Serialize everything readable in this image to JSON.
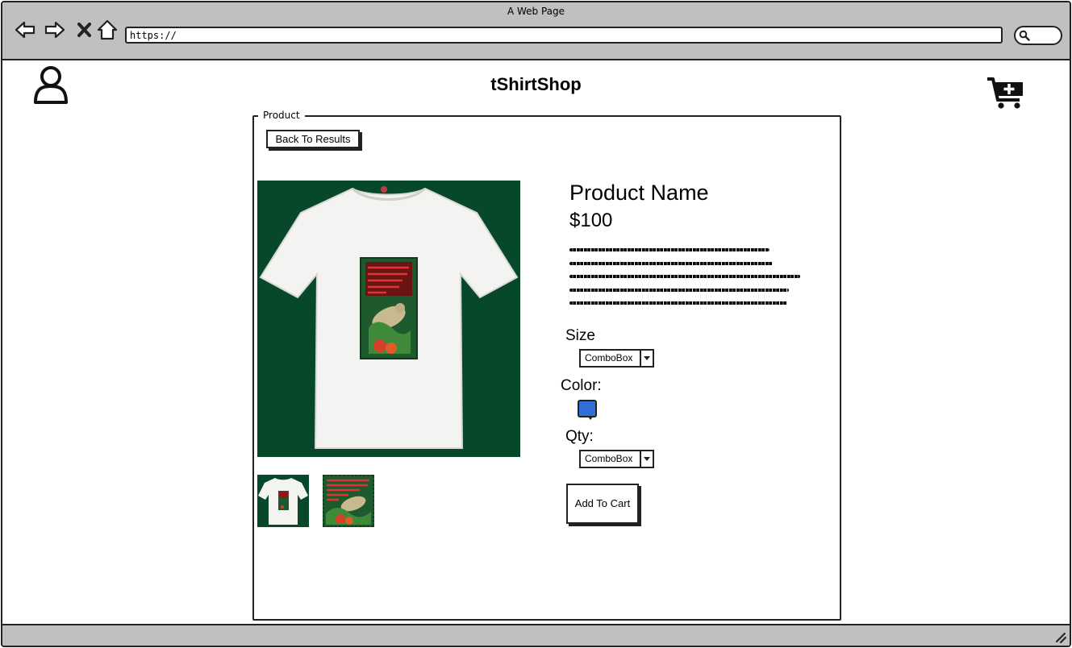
{
  "window": {
    "title": "A Web Page"
  },
  "browser": {
    "url": "https://",
    "icons": [
      "back-arrow-icon",
      "forward-arrow-icon",
      "close-icon",
      "home-icon",
      "search-icon"
    ]
  },
  "header": {
    "site_title": "tShirtShop",
    "user_icon": "user-icon",
    "cart_icon": "cart-add-icon"
  },
  "product": {
    "panel_label": "Product",
    "back_button": "Back To Results",
    "name": "Product Name",
    "price": "$100",
    "size_label": "Size",
    "size_value": "ComboBox",
    "color_label": "Color:",
    "color_value": "#2f6fd6",
    "qty_label": "Qty:",
    "qty_value": "ComboBox",
    "add_to_cart": "Add To Cart"
  },
  "colors": {
    "chrome": "#c0c0c0",
    "image_background": "#07472a",
    "outline": "#222222"
  }
}
